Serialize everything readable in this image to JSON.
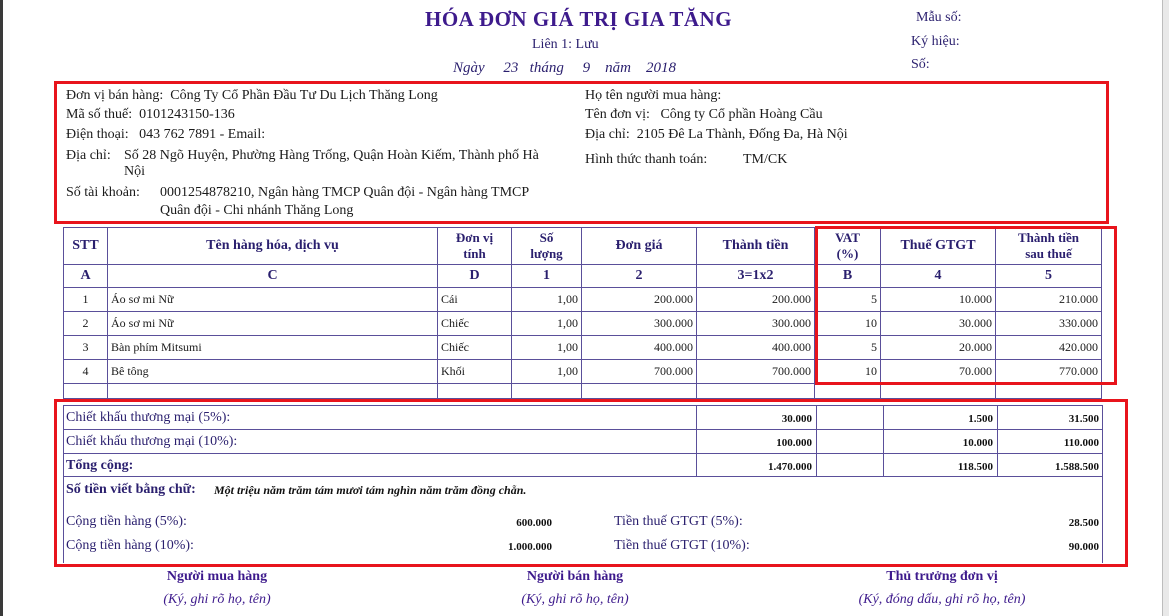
{
  "header": {
    "title": "HÓA ĐƠN GIÁ TRỊ GIA TĂNG",
    "copy": "Liên 1: Lưu",
    "date_prefix": "Ngày",
    "day": "23",
    "month_label": "tháng",
    "month": "9",
    "year_label": "năm",
    "year": "2018",
    "form_no_label": "Mẫu số:",
    "symbol_label": "Ký hiệu:",
    "number_label": "Số:"
  },
  "seller": {
    "name_label": "Đơn vị bán hàng:",
    "name": "Công Ty Cổ Phần Đầu Tư Du Lịch Thăng Long",
    "tax_label": "Mã số thuế:",
    "tax": "0101243150-136",
    "phone_label": "Điện thoại:",
    "phone": "043 762 7891 - Email:",
    "address_label": "Địa chỉ:",
    "address_line1": "Số 28 Ngõ Huyện, Phường Hàng Trống, Quận Hoàn Kiếm, Thành phố Hà",
    "address_line2": "Nội",
    "account_label": "Số tài khoản:",
    "account_line1": "0001254878210, Ngân hàng TMCP Quân đội  - Ngân hàng TMCP",
    "account_line2": "Quân đội - Chi nhánh Thăng Long"
  },
  "buyer": {
    "person_label": "Họ tên người mua hàng:",
    "unit_label": "Tên đơn vị:",
    "unit": "Công ty Cổ phần Hoàng Cầu",
    "address_label": "Địa chỉ:",
    "address": "2105 Đê La Thành, Đống Đa, Hà Nội",
    "payment_label": "Hình thức thanh toán:",
    "payment": "TM/CK"
  },
  "table": {
    "headers": {
      "stt": "STT",
      "name": "Tên hàng hóa, dịch vụ",
      "unit_1": "Đơn vị",
      "unit_2": "tính",
      "qty_1": "Số",
      "qty_2": "lượng",
      "price": "Đơn giá",
      "amount": "Thành tiền",
      "vat_1": "VAT",
      "vat_2": "(%)",
      "tax": "Thuế GTGT",
      "total_1": "Thành tiền",
      "total_2": "sau thuế"
    },
    "index": [
      "A",
      "C",
      "D",
      "1",
      "2",
      "3=1x2",
      "B",
      "4",
      "5"
    ],
    "rows": [
      {
        "stt": "1",
        "name": "Áo sơ mi Nữ",
        "unit": "Cái",
        "qty": "1,00",
        "price": "200.000",
        "amount": "200.000",
        "vat": "5",
        "tax": "10.000",
        "total": "210.000"
      },
      {
        "stt": "2",
        "name": "Áo sơ mi Nữ",
        "unit": "Chiếc",
        "qty": "1,00",
        "price": "300.000",
        "amount": "300.000",
        "vat": "10",
        "tax": "30.000",
        "total": "330.000"
      },
      {
        "stt": "3",
        "name": "Bàn phím Mitsumi",
        "unit": "Chiếc",
        "qty": "1,00",
        "price": "400.000",
        "amount": "400.000",
        "vat": "5",
        "tax": "20.000",
        "total": "420.000"
      },
      {
        "stt": "4",
        "name": "Bê tông",
        "unit": "Khối",
        "qty": "1,00",
        "price": "700.000",
        "amount": "700.000",
        "vat": "10",
        "tax": "70.000",
        "total": "770.000"
      }
    ]
  },
  "summary": {
    "discount5_label": "Chiết khấu thương mại (5%):",
    "discount5_amount": "30.000",
    "discount5_tax": "1.500",
    "discount5_total": "31.500",
    "discount10_label": "Chiết khấu thương mại (10%):",
    "discount10_amount": "100.000",
    "discount10_tax": "10.000",
    "discount10_total": "110.000",
    "total_label": "Tổng cộng:",
    "total_amount": "1.470.000",
    "total_tax": "118.500",
    "total_total": "1.588.500",
    "words_label": "Số tiền viết bằng chữ:",
    "words": "Một triệu năm trăm tám mươi tám nghìn năm trăm đồng chẵn.",
    "goods5_label": "Cộng tiền hàng (5%):",
    "goods5": "600.000",
    "goods10_label": "Cộng tiền hàng (10%):",
    "goods10": "1.000.000",
    "tax5_label": "Tiền thuế GTGT (5%):",
    "tax5": "28.500",
    "tax10_label": "Tiền thuế GTGT (10%):",
    "tax10": "90.000"
  },
  "signatures": {
    "buyer": "Người mua hàng",
    "buyer_note": "(Ký, ghi rõ họ, tên)",
    "seller": "Người bán hàng",
    "seller_note": "(Ký, ghi rõ họ, tên)",
    "head": "Thủ trưởng đơn vị",
    "head_note": "(Ký, đóng dấu, ghi rõ họ, tên)"
  },
  "colors": {
    "highlight_border": "#e8141c",
    "text_primary": "#2a1f6e",
    "title": "#3d1a8c"
  }
}
